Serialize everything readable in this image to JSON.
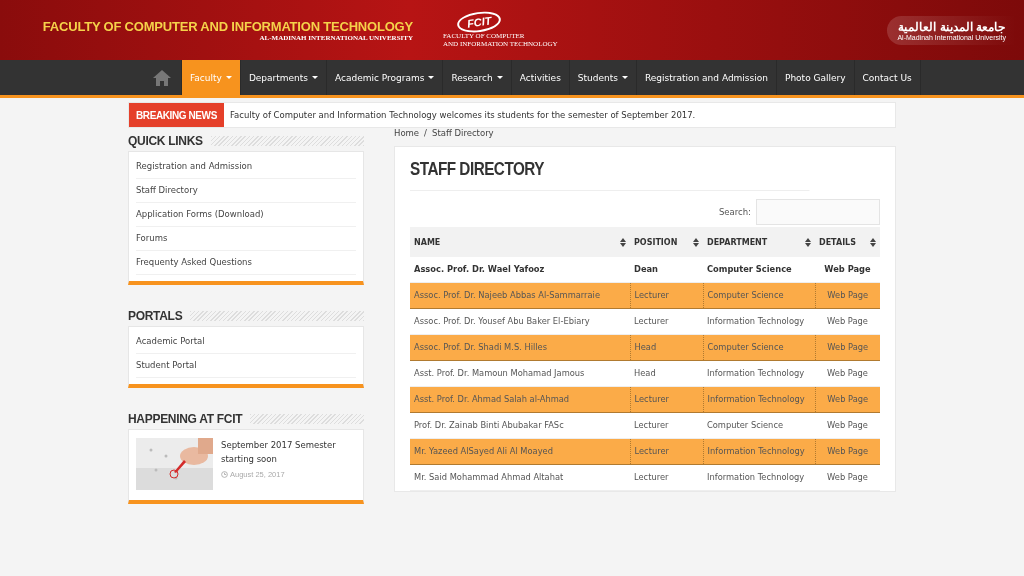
{
  "header": {
    "title": "FACULTY OF COMPUTER AND INFORMATION TECHNOLOGY",
    "subtitle": "AL-MADINAH INTERNATIONAL UNIVERSITY",
    "logo_text": "FCIT",
    "logo_caption_1": "FACULTY OF COMPUTER",
    "logo_caption_2": "AND INFORMATION TECHNOLOGY",
    "university_arabic": "جامعة المدينة العالمية",
    "university_english": "Al-Madinah International University"
  },
  "nav": [
    {
      "label": "Faculty",
      "dropdown": true,
      "selected": true
    },
    {
      "label": "Departments",
      "dropdown": true,
      "selected": false
    },
    {
      "label": "Academic Programs",
      "dropdown": true,
      "selected": false
    },
    {
      "label": "Research",
      "dropdown": true,
      "selected": false
    },
    {
      "label": "Activities",
      "dropdown": false,
      "selected": false
    },
    {
      "label": "Students",
      "dropdown": true,
      "selected": false
    },
    {
      "label": "Registration and Admission",
      "dropdown": false,
      "selected": false
    },
    {
      "label": "Photo Gallery",
      "dropdown": false,
      "selected": false
    },
    {
      "label": "Contact Us",
      "dropdown": false,
      "selected": false
    }
  ],
  "breaking_news": {
    "label": "BREAKING NEWS",
    "text": "Faculty of Computer and Information Technology welcomes its students for the semester of September 2017."
  },
  "breadcrumb": {
    "home": "Home",
    "separator": "/",
    "current": "Staff Directory"
  },
  "sidebar": [
    {
      "kind": "links",
      "title": "QUICK LINKS",
      "items": [
        "Registration and Admission",
        "Staff Directory",
        "Application Forms (Download)",
        "Forums",
        "Frequenty Asked Questions"
      ]
    },
    {
      "kind": "links",
      "title": "PORTALS",
      "items": [
        "Academic Portal",
        "Student Portal"
      ]
    },
    {
      "kind": "posts",
      "title": "HAPPENING AT FCIT",
      "posts": [
        {
          "title": "September 2017 Semester starting soon",
          "date": "August 25, 2017"
        }
      ]
    }
  ],
  "page_title": "STAFF DIRECTORY",
  "search": {
    "label": "Search:"
  },
  "table": {
    "columns": [
      "NAME",
      "POSITION",
      "DEPARTMENT",
      "DETAILS"
    ],
    "rows": [
      {
        "cells": [
          "Assoc. Prof. Dr. Wael Yafooz",
          "Dean",
          "Computer Science",
          "Web Page"
        ],
        "bold": true,
        "highlighted": false
      },
      {
        "cells": [
          "Assoc. Prof. Dr. Najeeb Abbas Al-Sammarraie",
          "Lecturer",
          "Computer Science",
          "Web Page"
        ],
        "bold": false,
        "highlighted": true
      },
      {
        "cells": [
          "Assoc. Prof. Dr. Yousef Abu Baker El-Ebiary",
          "Lecturer",
          "Information Technology",
          "Web Page"
        ],
        "bold": false,
        "highlighted": false
      },
      {
        "cells": [
          "Assoc. Prof. Dr. Shadi M.S. Hilles",
          "Head",
          "Computer Science",
          "Web Page"
        ],
        "bold": false,
        "highlighted": true
      },
      {
        "cells": [
          "Asst. Prof. Dr. Mamoun Mohamad Jamous",
          "Head",
          "Information Technology",
          "Web Page"
        ],
        "bold": false,
        "highlighted": false
      },
      {
        "cells": [
          "Asst. Prof. Dr. Ahmad Salah al-Ahmad",
          "Lecturer",
          "Information Technology",
          "Web Page"
        ],
        "bold": false,
        "highlighted": true
      },
      {
        "cells": [
          "Prof. Dr. Zainab Binti Abubakar FASc",
          "Lecturer",
          "Computer Science",
          "Web Page"
        ],
        "bold": false,
        "highlighted": false
      },
      {
        "cells": [
          "Mr. Yazeed AlSayed Ali Al Moayed",
          "Lecturer",
          "Information Technology",
          "Web Page"
        ],
        "bold": false,
        "highlighted": true
      },
      {
        "cells": [
          "Mr. Said Mohammad Ahmad Altahat",
          "Lecturer",
          "Information Technology",
          "Web Page"
        ],
        "bold": false,
        "highlighted": false
      }
    ]
  }
}
